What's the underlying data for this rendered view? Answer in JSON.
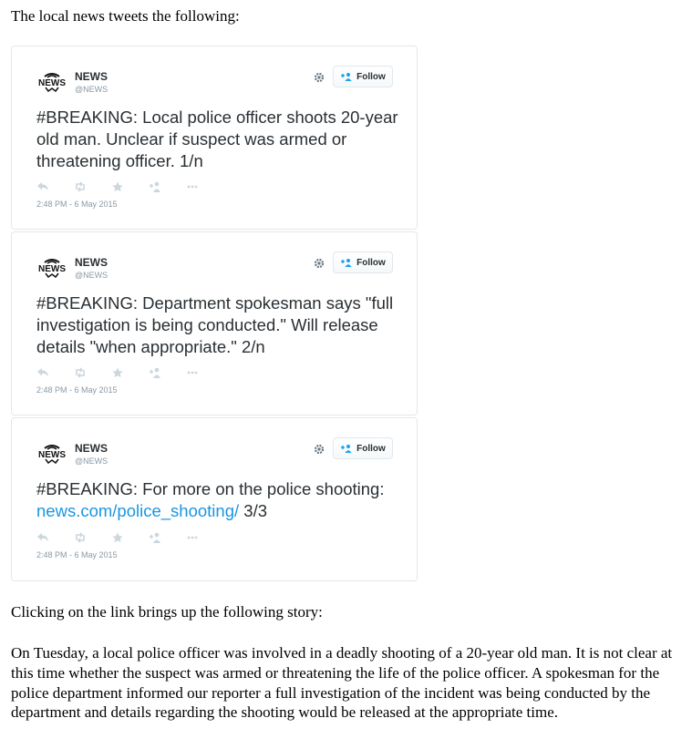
{
  "intro": "The local news tweets the following:",
  "tweets": [
    {
      "name": "NEWS",
      "handle": "@NEWS",
      "follow_label": "Follow",
      "text": "#BREAKING: Local police officer shoots 20-year old man. Unclear if suspect was armed or threatening officer. 1/n",
      "time": "2:48 PM - 6 May 2015"
    },
    {
      "name": "NEWS",
      "handle": "@NEWS",
      "follow_label": "Follow",
      "text": "#BREAKING: Department spokesman says \"full investigation is being conducted.\" Will release details \"when appropriate.\" 2/n",
      "time": "2:48 PM - 6 May 2015"
    },
    {
      "name": "NEWS",
      "handle": "@NEWS",
      "follow_label": "Follow",
      "text_before": "#BREAKING: For more on the police shooting: ",
      "link": "news.com/police_shooting/",
      "text_after": " 3/3",
      "time": "2:48 PM - 6 May 2015"
    }
  ],
  "logo_text": "NEWS",
  "icons": [
    "news-logo-icon",
    "gear-icon",
    "add-user-icon",
    "reply-icon",
    "retweet-icon",
    "favorite-star-icon",
    "follow-icon",
    "more-dots-icon"
  ],
  "colors": {
    "link": "#1b95e0",
    "border": "#e1e8ed",
    "meta": "#8899a6",
    "follow_icon": "#1da1f2"
  },
  "story_lead": "Clicking on the link brings up the following story:",
  "story": "On Tuesday, a local police officer was involved in a deadly shooting of a 20-year old man. It is not clear at this time whether the suspect was armed or threatening the life of the police officer. A spokesman for the police department informed our reporter a full investigation of the incident was being conducted by the department and details regarding the shooting would be released at the appropriate time."
}
